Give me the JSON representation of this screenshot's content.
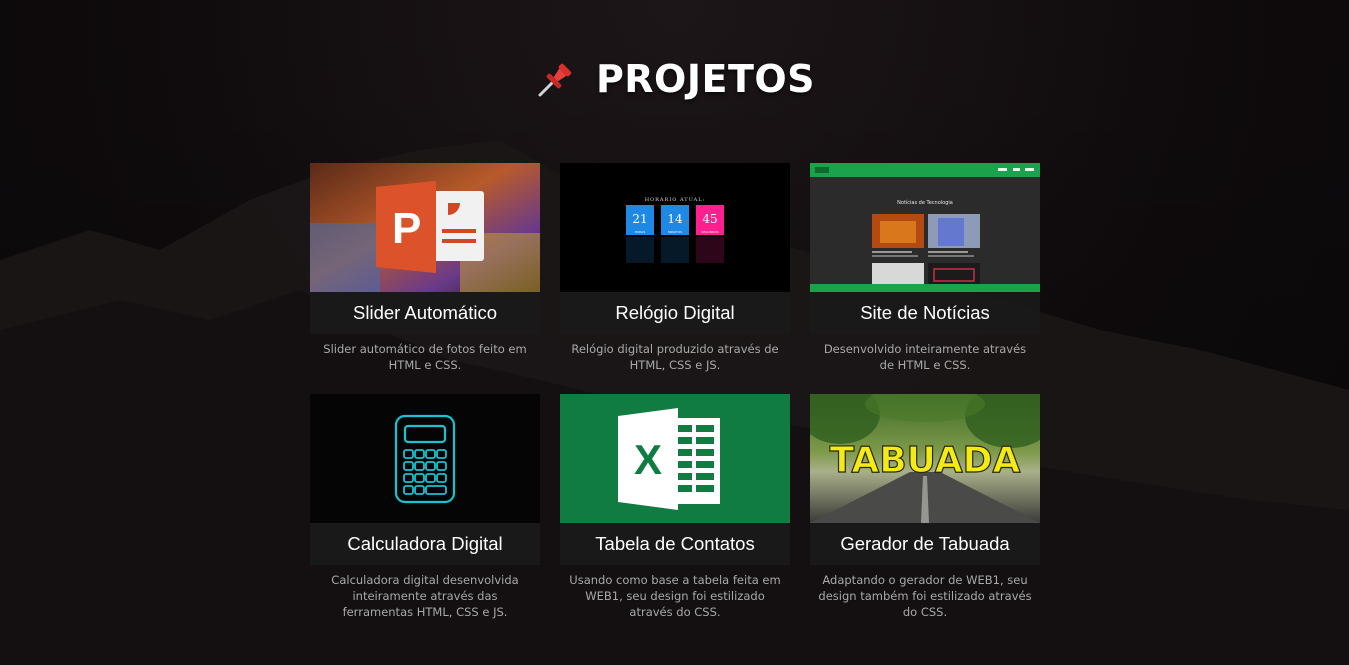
{
  "header": {
    "title": "PROJETOS",
    "icon": "pushpin-icon"
  },
  "colors": {
    "background": "#0f0b0d",
    "card_title_bg": "#1a1a1a",
    "description_text": "#a9a9a9",
    "excel_green": "#107c41",
    "powerpoint_orange": "#d24726",
    "news_site_green": "#1aa34a",
    "calculator_cyan": "#17c3d1"
  },
  "projects": [
    {
      "title": "Slider Automático",
      "description": "Slider automático de fotos feito em HTML e CSS.",
      "thumbnail": "powerpoint-icon"
    },
    {
      "title": "Relógio Digital",
      "description": "Relógio digital produzido através de HTML, CSS e JS.",
      "thumbnail": "digital-clock-preview",
      "clock": {
        "heading": "HORÁRIO ATUAL:",
        "hours": "21",
        "minutes": "14",
        "seconds": "45",
        "hours_label": "HORAS",
        "minutes_label": "MINUTOS",
        "seconds_label": "SEGUNDOS"
      }
    },
    {
      "title": "Site de Notícias",
      "description": "Desenvolvido inteiramente através de HTML e CSS.",
      "thumbnail": "news-site-preview",
      "preview_heading": "Notícias de Tecnologia"
    },
    {
      "title": "Calculadora Digital",
      "description": "Calculadora digital desenvolvida inteiramente através das ferramentas HTML, CSS e JS.",
      "thumbnail": "calculator-icon"
    },
    {
      "title": "Tabela de Contatos",
      "description": "Usando como base a tabela feita em WEB1, seu design foi estilizado através do CSS.",
      "thumbnail": "excel-icon"
    },
    {
      "title": "Gerador de Tabuada",
      "description": "Adaptando o gerador de WEB1, seu design também foi estilizado através do CSS.",
      "thumbnail": "tabuada-road-image",
      "thumb_text": "TABUADA"
    }
  ]
}
